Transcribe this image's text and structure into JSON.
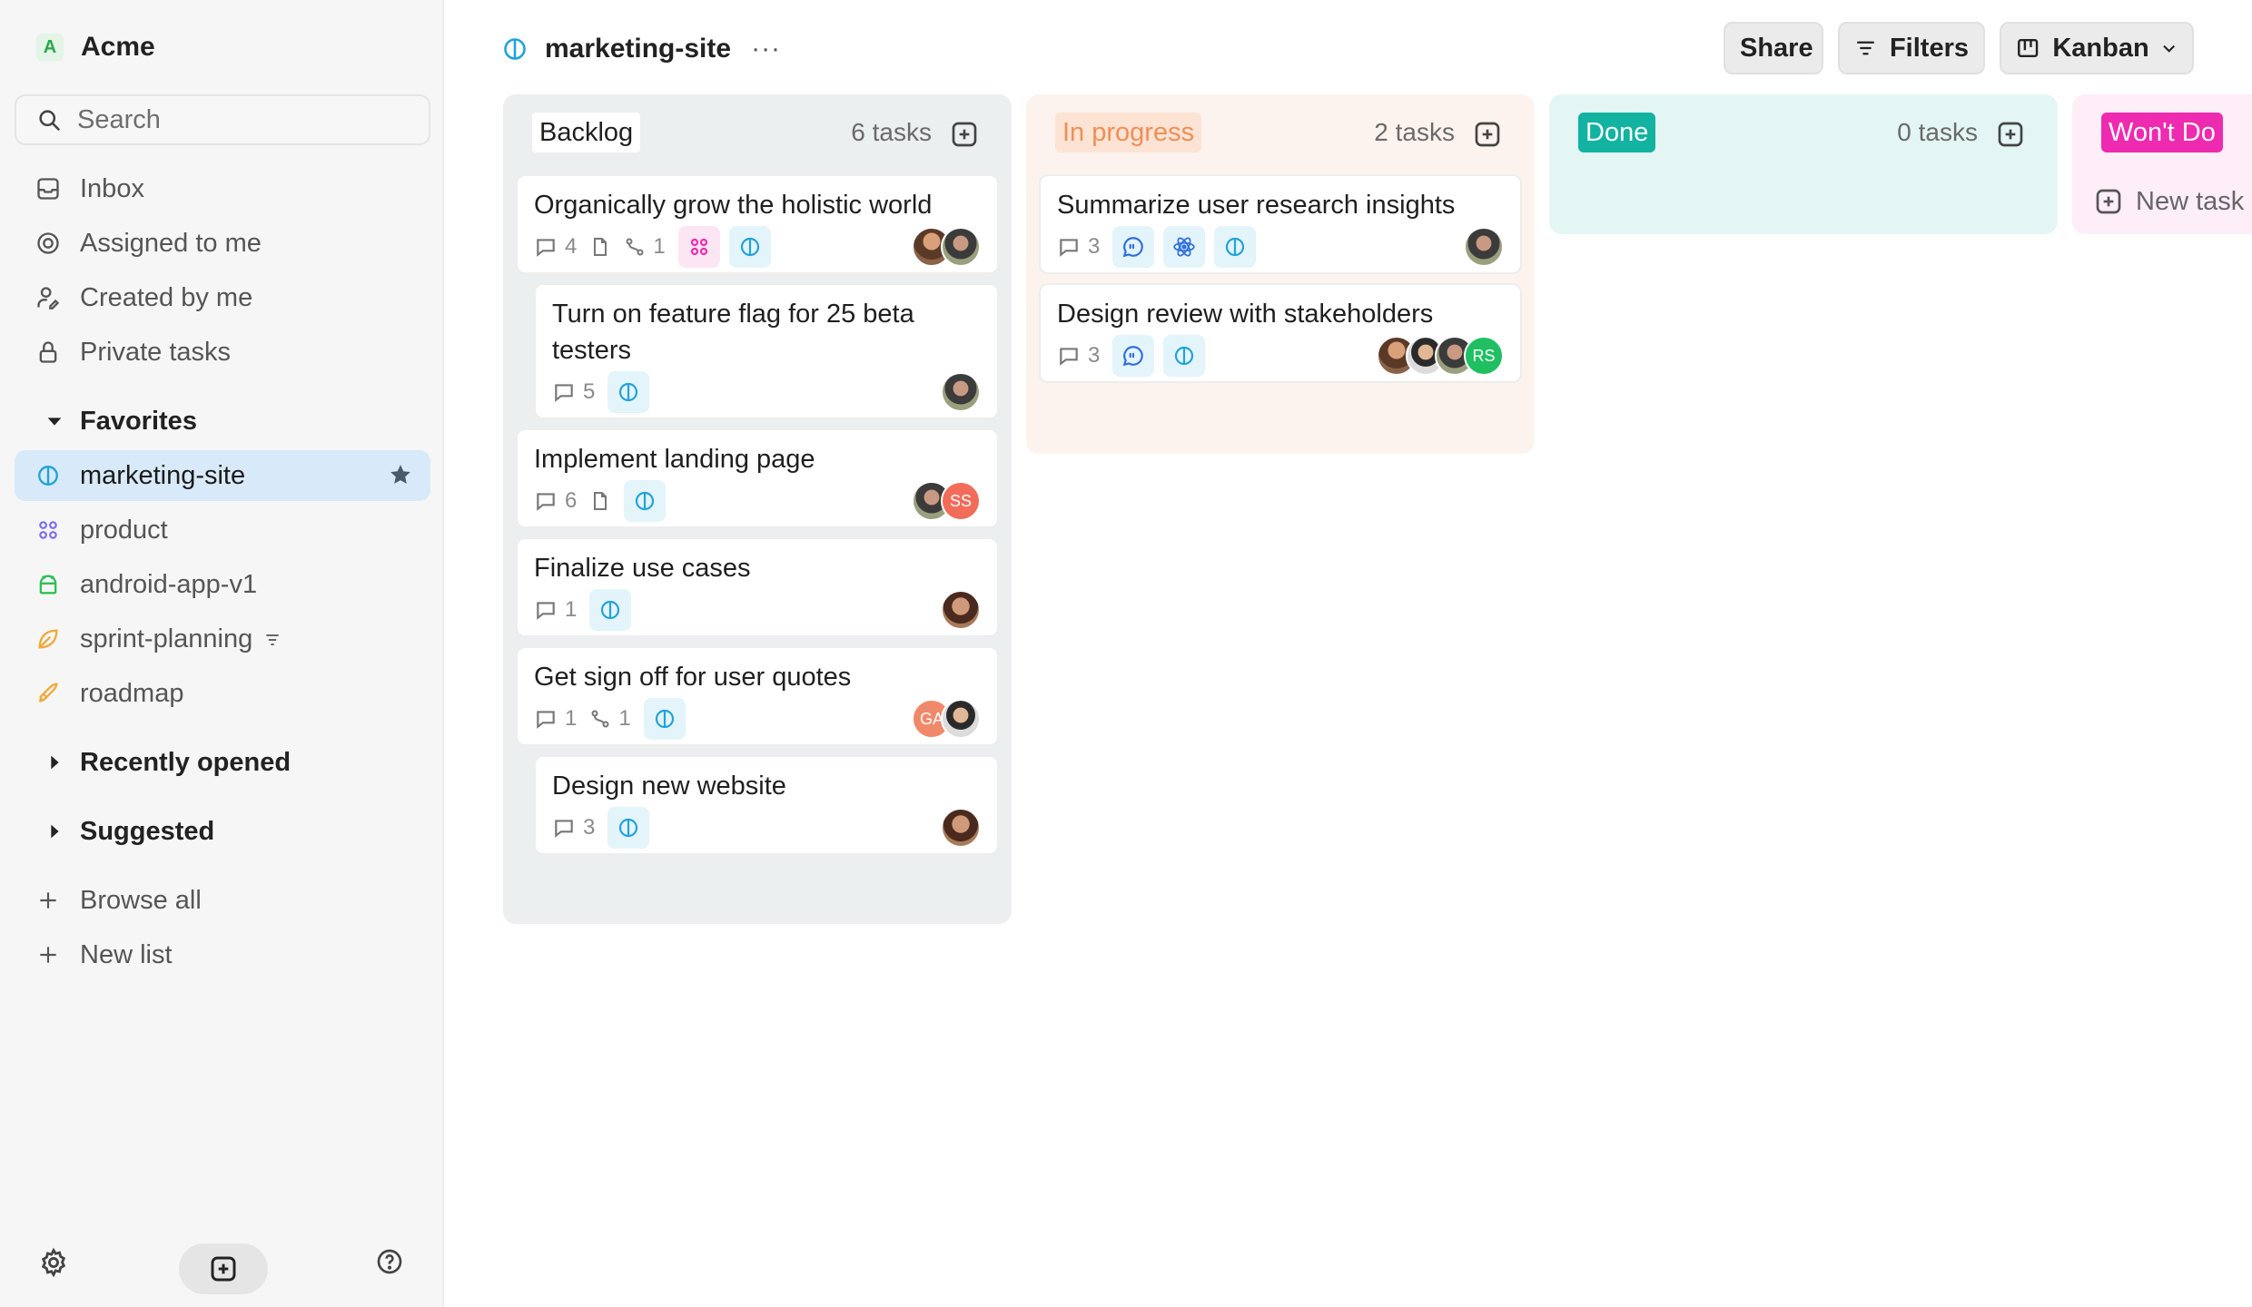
{
  "workspace": {
    "badge": "A",
    "name": "Acme"
  },
  "search": {
    "placeholder": "Search"
  },
  "nav": [
    {
      "label": "Inbox",
      "icon": "inbox-icon"
    },
    {
      "label": "Assigned to me",
      "icon": "target-icon"
    },
    {
      "label": "Created by me",
      "icon": "user-edit-icon"
    },
    {
      "label": "Private tasks",
      "icon": "lock-icon"
    }
  ],
  "favorites": {
    "heading": "Favorites",
    "items": [
      {
        "label": "marketing-site",
        "icon": "half-circle-icon",
        "active": true
      },
      {
        "label": "product",
        "icon": "grid-dots-icon"
      },
      {
        "label": "android-app-v1",
        "icon": "android-icon"
      },
      {
        "label": "sprint-planning",
        "icon": "leaf-icon"
      },
      {
        "label": "roadmap",
        "icon": "rocket-icon"
      }
    ]
  },
  "sections": {
    "recent": "Recently opened",
    "suggested": "Suggested"
  },
  "actions": {
    "browse": "Browse all",
    "new_list": "New list"
  },
  "header": {
    "title": "marketing-site",
    "more": "···",
    "share": "Share",
    "filters": "Filters",
    "view": "Kanban"
  },
  "colors": {
    "backlog_bg": "#ecefef",
    "progress_bg": "#fdf3ee",
    "done_bg": "#e4f6f4",
    "wontdo_bg": "#fdeef8",
    "done_pill": "#12b3a0",
    "wontdo_pill": "#ee2bb0",
    "progress_pill_text": "#ef8f55",
    "accent_blue": "#21a3d9"
  },
  "columns": {
    "backlog": {
      "name": "Backlog",
      "count": "6 tasks",
      "cards": [
        {
          "title": "Organically grow the holistic world",
          "comments": "4",
          "links": "1"
        },
        {
          "title_line1": "Turn on feature flag for 25 beta",
          "title_line2": "testers",
          "comments": "5"
        },
        {
          "title": "Implement landing page",
          "comments": "6",
          "avatar_initials": "SS"
        },
        {
          "title": "Finalize use cases",
          "comments": "1"
        },
        {
          "title": "Get sign off for user quotes",
          "comments": "1",
          "links": "1",
          "avatar_initials": "GA"
        },
        {
          "title": "Design new website",
          "comments": "3"
        }
      ]
    },
    "progress": {
      "name": "In progress",
      "count": "2 tasks",
      "cards": [
        {
          "title": "Summarize user research insights",
          "comments": "3"
        },
        {
          "title": "Design review with stakeholders",
          "comments": "3",
          "avatar_initials": "RS"
        }
      ]
    },
    "done": {
      "name": "Done",
      "count": "0 tasks"
    },
    "wontdo": {
      "name": "Won't Do",
      "new_task": "New task"
    }
  }
}
